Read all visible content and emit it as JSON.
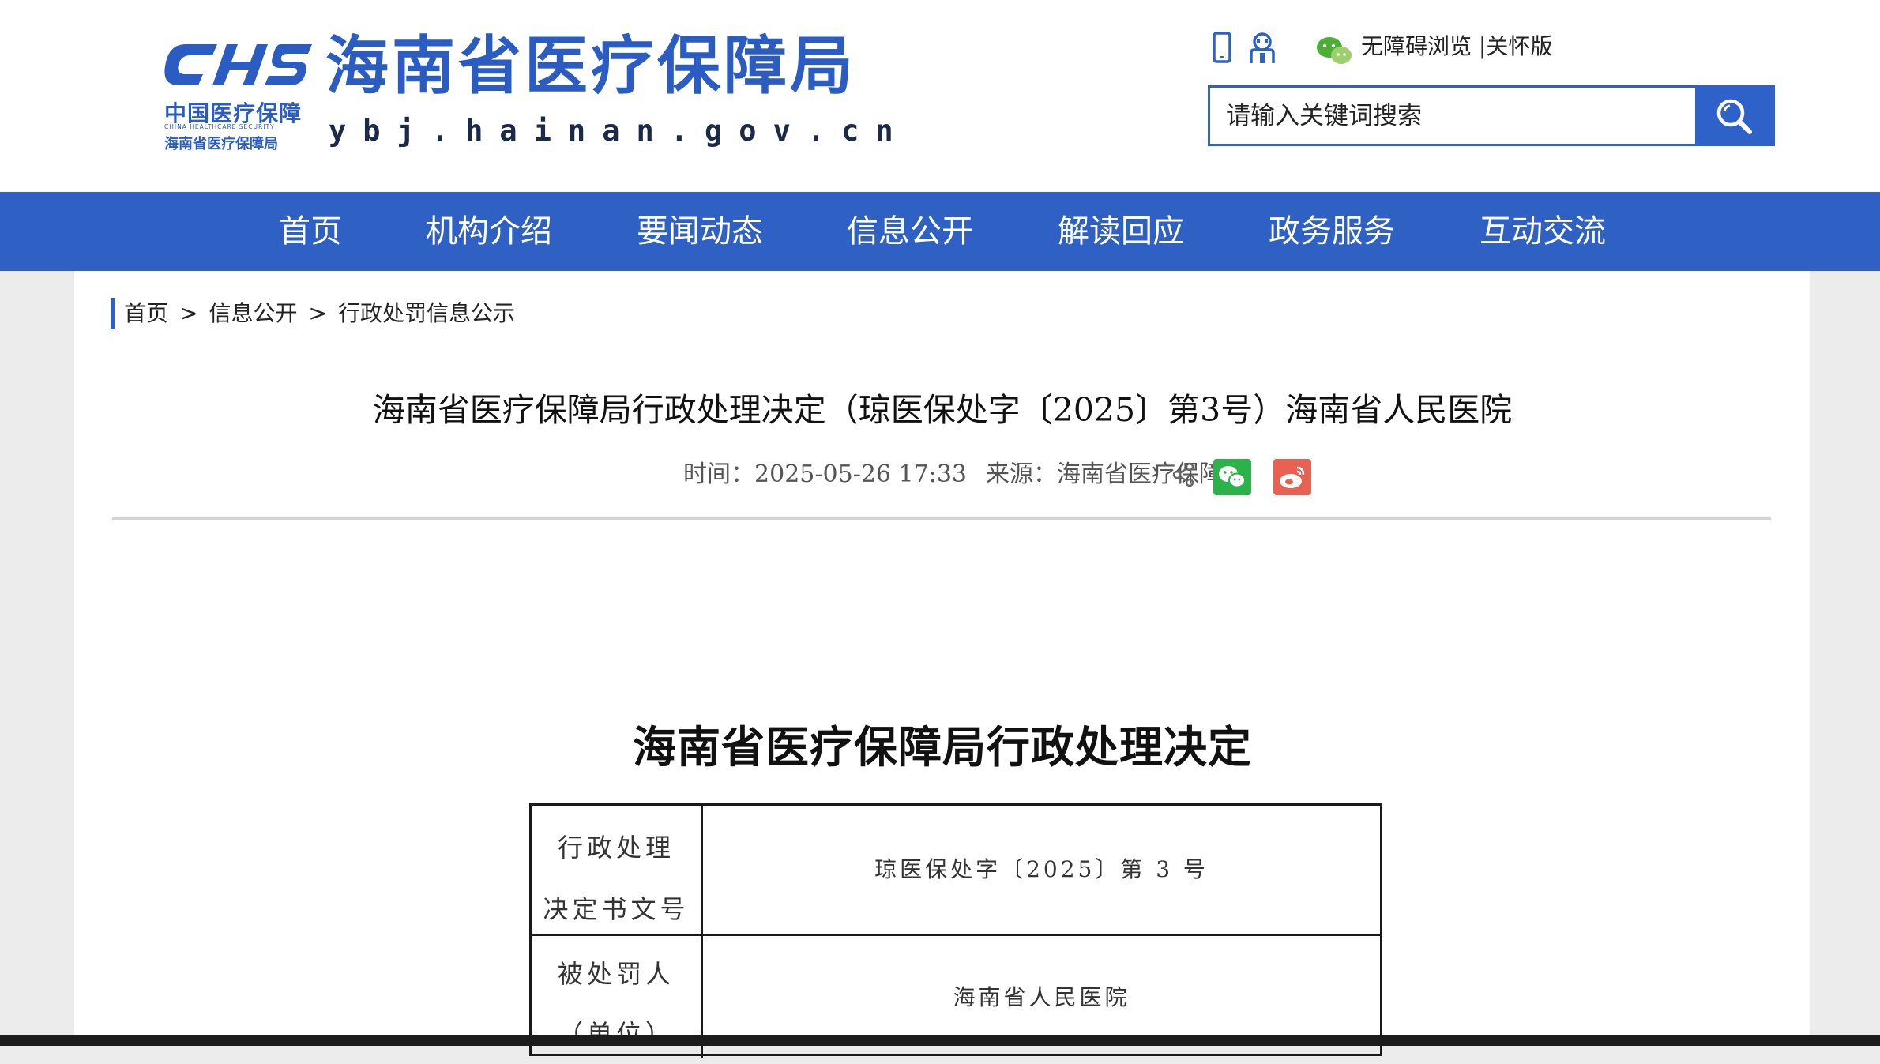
{
  "header": {
    "logo_mark": "CHS",
    "logo_cn": "中国医疗保障",
    "logo_en": "CHINA HEALTHCARE SECURITY",
    "logo_sub": "海南省医疗保障局",
    "site_title": "海南省医疗保障局",
    "site_domain": "ybj.hainan.gov.cn",
    "access_text": "无障碍浏览 |关怀版",
    "icons": [
      "mobile-icon",
      "robot-icon",
      "wechat-icon"
    ]
  },
  "search": {
    "placeholder": "请输入关键词搜索",
    "icon": "search-icon"
  },
  "nav": {
    "items": [
      "首页",
      "机构介绍",
      "要闻动态",
      "信息公开",
      "解读回应",
      "政务服务",
      "互动交流"
    ]
  },
  "breadcrumb": {
    "items": [
      "首页",
      "信息公开",
      "行政处罚信息公示"
    ],
    "separator": ">"
  },
  "article": {
    "title": "海南省医疗保障局行政处理决定（琼医保处字〔2025〕第3号）海南省人民医院",
    "time_label": "时间：",
    "time": "2025-05-26 17:33",
    "source_label": "来源：",
    "source": "海南省医疗保障局"
  },
  "share": {
    "icons": [
      "share-icon",
      "wechat-share-icon",
      "weibo-share-icon"
    ],
    "colors": {
      "wechat": "#2bb34a",
      "weibo": "#e86151"
    }
  },
  "document": {
    "heading": "海南省医疗保障局行政处理决定",
    "rows": [
      {
        "label_line1": "行政处理",
        "label_line2": "决定书文号",
        "value": "琼医保处字〔2025〕第 3 号"
      },
      {
        "label_line1": "被处罚人",
        "label_line2": "（单位）",
        "value": "海南省人民医院"
      }
    ]
  },
  "theme": {
    "brand_blue": "#2f61c5"
  }
}
